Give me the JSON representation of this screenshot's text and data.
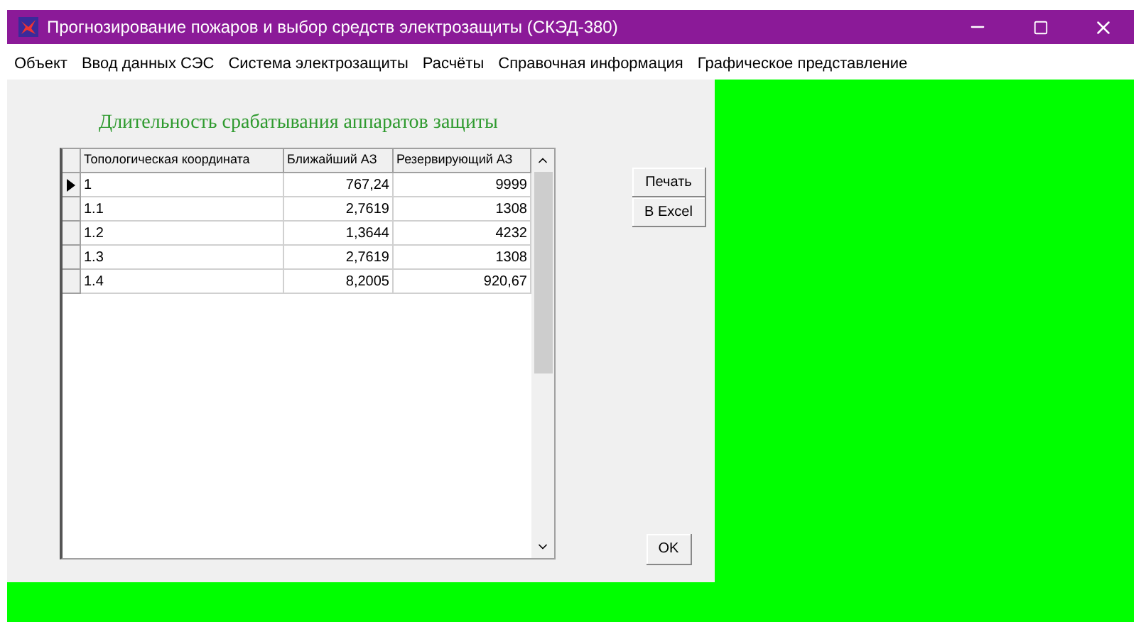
{
  "window": {
    "title": "Прогнозирование пожаров и выбор средств электрозащиты (СКЭД-380)"
  },
  "menu": [
    "Объект",
    "Ввод данных СЭС",
    "Система электрозащиты",
    "Расчёты",
    "Справочная информация",
    "Графическое представление"
  ],
  "panel": {
    "title": "Длительность срабатывания аппаратов защиты"
  },
  "table": {
    "columns": [
      "Топологическая координата",
      "Ближайший АЗ",
      "Резервирующий АЗ"
    ],
    "rows": [
      {
        "cells": [
          "1",
          "767,24",
          "9999"
        ],
        "selected": true
      },
      {
        "cells": [
          "1.1",
          "2,7619",
          "1308"
        ],
        "selected": false
      },
      {
        "cells": [
          "1.2",
          "1,3644",
          "4232"
        ],
        "selected": false
      },
      {
        "cells": [
          "1.3",
          "2,7619",
          "1308"
        ],
        "selected": false
      },
      {
        "cells": [
          "1.4",
          "8,2005",
          "920,67"
        ],
        "selected": false
      }
    ]
  },
  "buttons": [
    "Печать",
    "В Excel"
  ],
  "ok_button": "OK"
}
